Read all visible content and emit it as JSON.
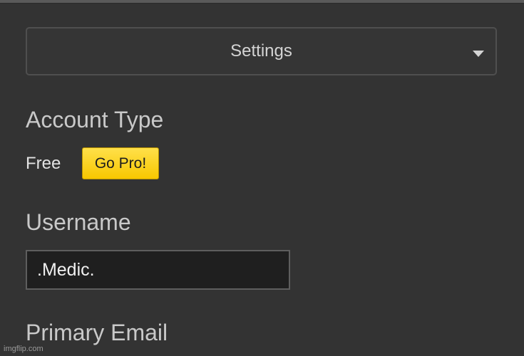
{
  "settings_dropdown": {
    "selected": "Settings",
    "caret_icon": "caret-down-icon"
  },
  "account_type": {
    "heading": "Account Type",
    "value": "Free",
    "upgrade_label": "Go Pro!",
    "upgrade_color": "#f7c700"
  },
  "username": {
    "heading": "Username",
    "value": ".Medic."
  },
  "primary_email": {
    "heading": "Primary Email"
  },
  "watermark": "imgflip.com",
  "colors": {
    "background": "#333333",
    "input_background": "#1f1f1f",
    "text": "#d9d9d9"
  }
}
